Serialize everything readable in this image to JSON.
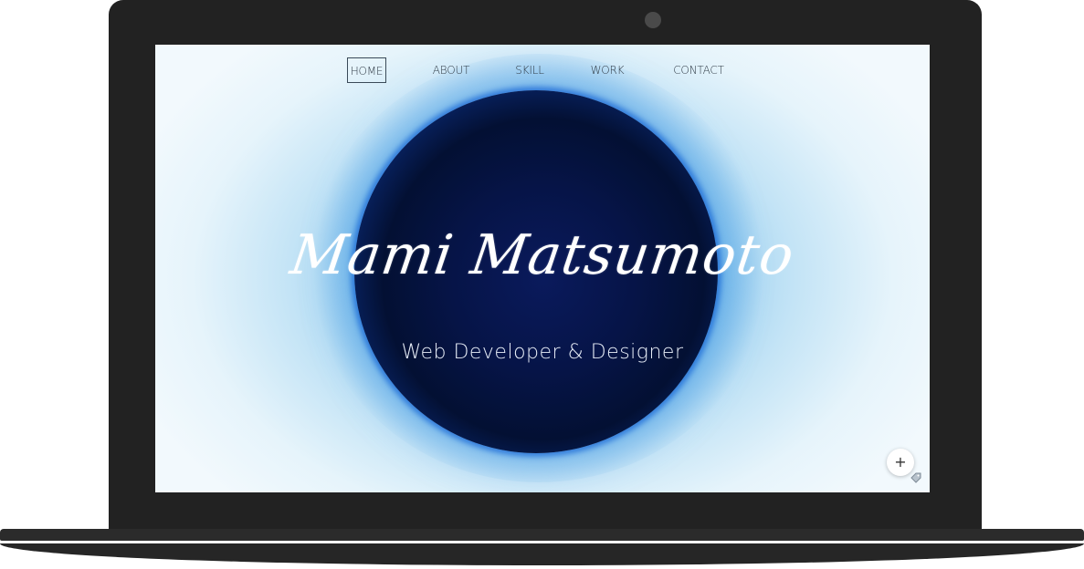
{
  "nav": {
    "items": [
      {
        "label": "HOME",
        "active": true
      },
      {
        "label": "ABOUT",
        "active": false
      },
      {
        "label": "SKILL",
        "active": false
      },
      {
        "label": "WORK",
        "active": false
      },
      {
        "label": "CONTACT",
        "active": false
      }
    ]
  },
  "hero": {
    "title": "Mami Matsumoto",
    "subtitle": "Web Developer & Designer"
  },
  "fab": {
    "label": "+",
    "icon": "plus-icon"
  },
  "colors": {
    "bezel": "#222222",
    "orb_core": "#031033",
    "orb_rim": "#1a6ddc",
    "background_light": "#e6f4fb",
    "nav_text": "#2f3a45",
    "title_text": "#ffffff"
  }
}
